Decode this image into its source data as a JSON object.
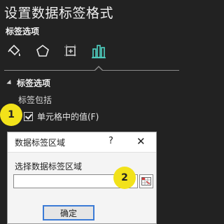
{
  "pane": {
    "title": "设置数据标签格式",
    "subtitle": "标签选项",
    "tabs": [
      {
        "name": "fill-line",
        "icon": "paint-bucket-icon"
      },
      {
        "name": "effects",
        "icon": "pentagon-icon"
      },
      {
        "name": "size-properties",
        "icon": "size-properties-icon"
      },
      {
        "name": "label-options",
        "icon": "bar-chart-icon",
        "active": true
      }
    ],
    "section_header": "标签选项",
    "label_contains": "标签包括",
    "checkbox_label": "单元格中的值(F)",
    "checkbox_checked": true
  },
  "badges": {
    "step1": "1",
    "step2": "2"
  },
  "dialog": {
    "title": "数据标签区域",
    "help": "?",
    "close": "✕",
    "prompt": "选择数据标签区域",
    "input_value": "",
    "ok_label": "确定"
  },
  "colors": {
    "pane_bg": "#222222",
    "active_tab": "#4fd3c4",
    "badge": "#f2e21a",
    "ok_border": "#3b7bd6"
  }
}
